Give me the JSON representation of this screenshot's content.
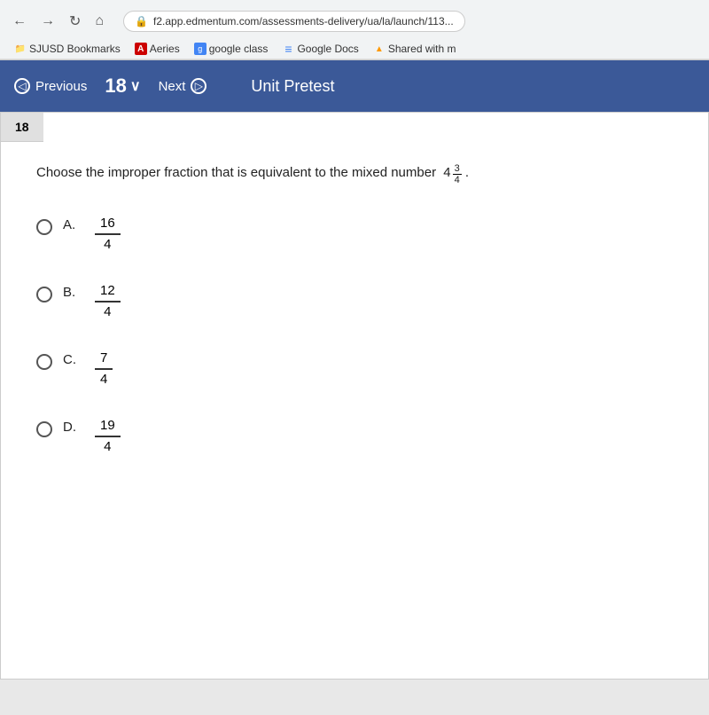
{
  "browser": {
    "back_icon": "←",
    "forward_icon": "→",
    "refresh_icon": "↻",
    "home_icon": "⌂",
    "url": "f2.app.edmentum.com/assessments-delivery/ua/la/launch/113...",
    "lock_icon": "🔒"
  },
  "bookmarks": {
    "bar_label": "SJUSD Bookmarks",
    "items": [
      {
        "label": "SJUSD Bookmarks",
        "icon": "📁"
      },
      {
        "label": "Aeries",
        "icon": "A"
      },
      {
        "label": "google class",
        "icon": "g"
      },
      {
        "label": "Google Docs",
        "icon": "≡"
      },
      {
        "label": "Shared with m",
        "icon": "▲"
      }
    ]
  },
  "toolbar": {
    "previous_label": "Previous",
    "next_label": "Next",
    "question_number": "18",
    "dropdown_icon": "∨",
    "title": "Unit Pretest"
  },
  "question": {
    "number": "18",
    "text": "Choose the improper fraction that is equivalent to the mixed number",
    "mixed_whole": "4",
    "mixed_numerator": "3",
    "mixed_denominator": "4",
    "period": ".",
    "options": [
      {
        "letter": "A.",
        "numerator": "16",
        "denominator": "4"
      },
      {
        "letter": "B.",
        "numerator": "12",
        "denominator": "4"
      },
      {
        "letter": "C.",
        "numerator": "7",
        "denominator": "4"
      },
      {
        "letter": "D.",
        "numerator": "19",
        "denominator": "4"
      }
    ]
  }
}
